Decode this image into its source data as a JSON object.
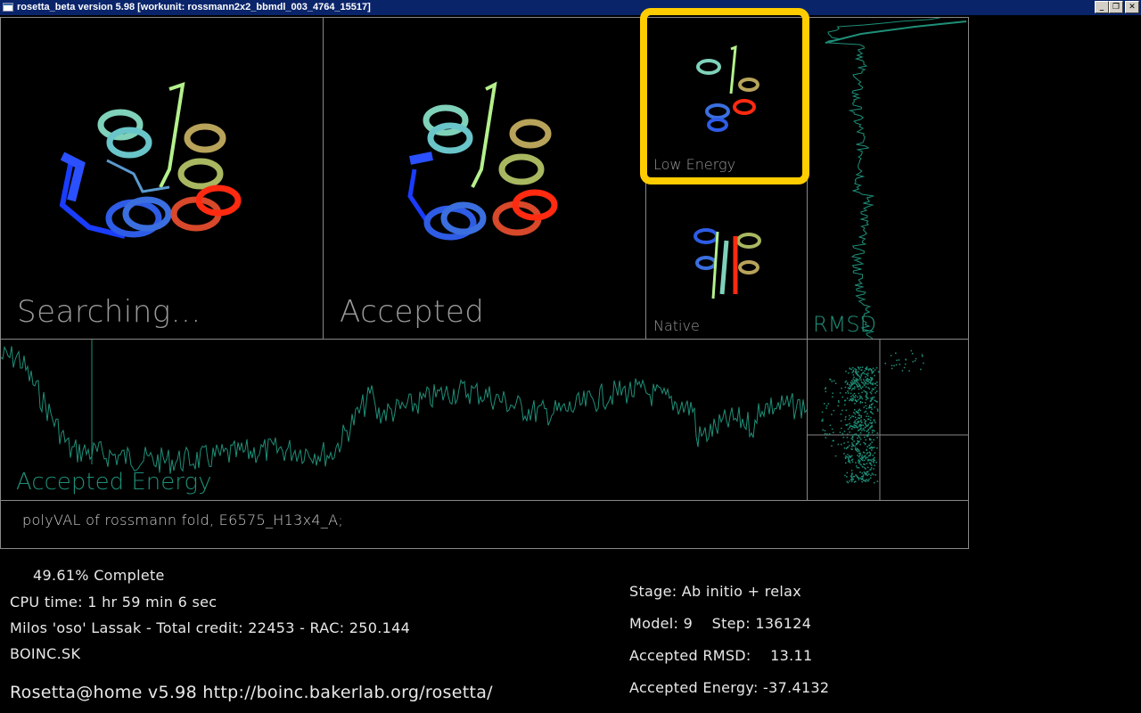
{
  "window": {
    "title": "rosetta_beta version 5.98 [workunit: rossmann2x2_bbmdl_003_4764_15517]",
    "buttons": {
      "minimize": "_",
      "restore": "❐",
      "close": "✕"
    }
  },
  "panels": {
    "searching_label": "Searching...",
    "accepted_label": "Accepted",
    "low_energy_label": "Low Energy",
    "native_label": "Native",
    "rmsd_label": "RMSD",
    "accepted_energy_label": "Accepted Energy"
  },
  "description": "polyVAL of rossmann fold, E6575_H13x4_A;",
  "status": {
    "percent_complete": "49.61% Complete",
    "cpu_time": "CPU time: 1 hr 59 min 6 sec",
    "user_credit": "Milos 'oso' Lassak - Total credit: 22453 - RAC: 250.144",
    "team": "BOINC.SK",
    "project": "Rosetta@home v5.98 http://boinc.bakerlab.org/rosetta/"
  },
  "stats": {
    "stage": "Stage: Ab initio + relax",
    "model_step": "Model: 9    Step: 136124",
    "accepted_rmsd": "Accepted RMSD:    13.11",
    "accepted_energy": "Accepted Energy: -37.4132"
  },
  "colors": {
    "plot": "#1f8f78",
    "highlight": "#ffcc00",
    "panel_border": "#888888"
  }
}
